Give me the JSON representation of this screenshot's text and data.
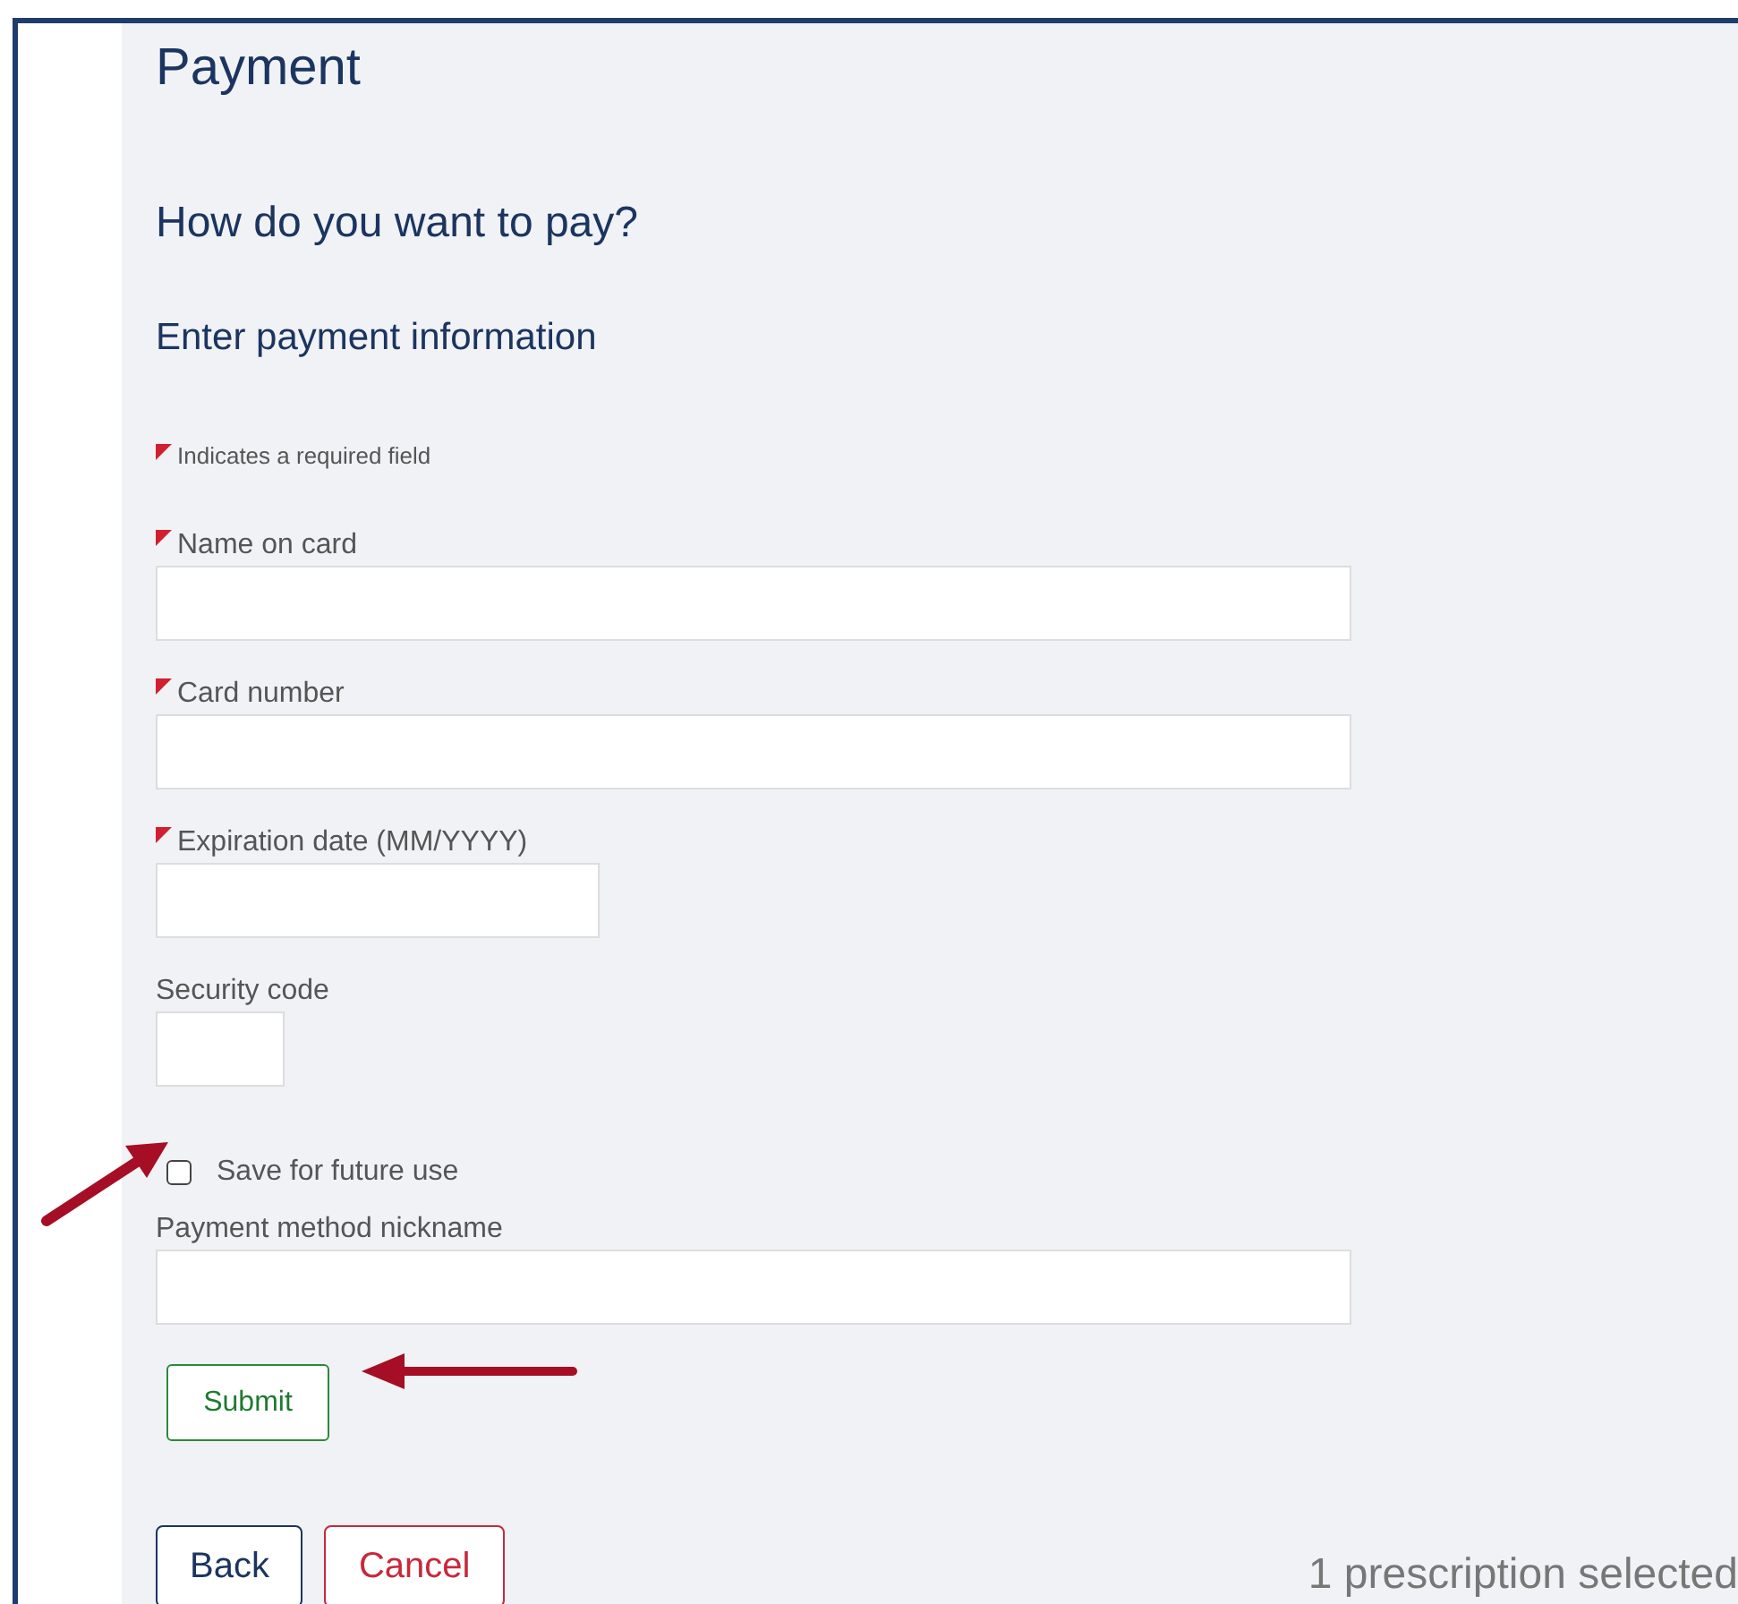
{
  "page_title": "Payment",
  "question": "How do you want to pay?",
  "section_title": "Enter payment information",
  "required_note": "Indicates a required field",
  "fields": [
    {
      "kind": "wide",
      "label": "Name on card",
      "required": true
    },
    {
      "kind": "wide",
      "label": "Card number",
      "required": true
    },
    {
      "kind": "date",
      "label": "Expiration date (MM/YYYY)",
      "required": true
    },
    {
      "kind": "code",
      "label": "Security code",
      "required": false
    },
    {
      "kind": "checkbox",
      "label": "Save for future use",
      "checked": false
    },
    {
      "kind": "wide",
      "label": "Payment method nickname",
      "required": false
    }
  ],
  "submit": "Submit",
  "buttons": [
    {
      "kind": "back",
      "label": "Back"
    },
    {
      "kind": "cancel",
      "label": "Cancel"
    }
  ],
  "status": "1 prescription selected"
}
